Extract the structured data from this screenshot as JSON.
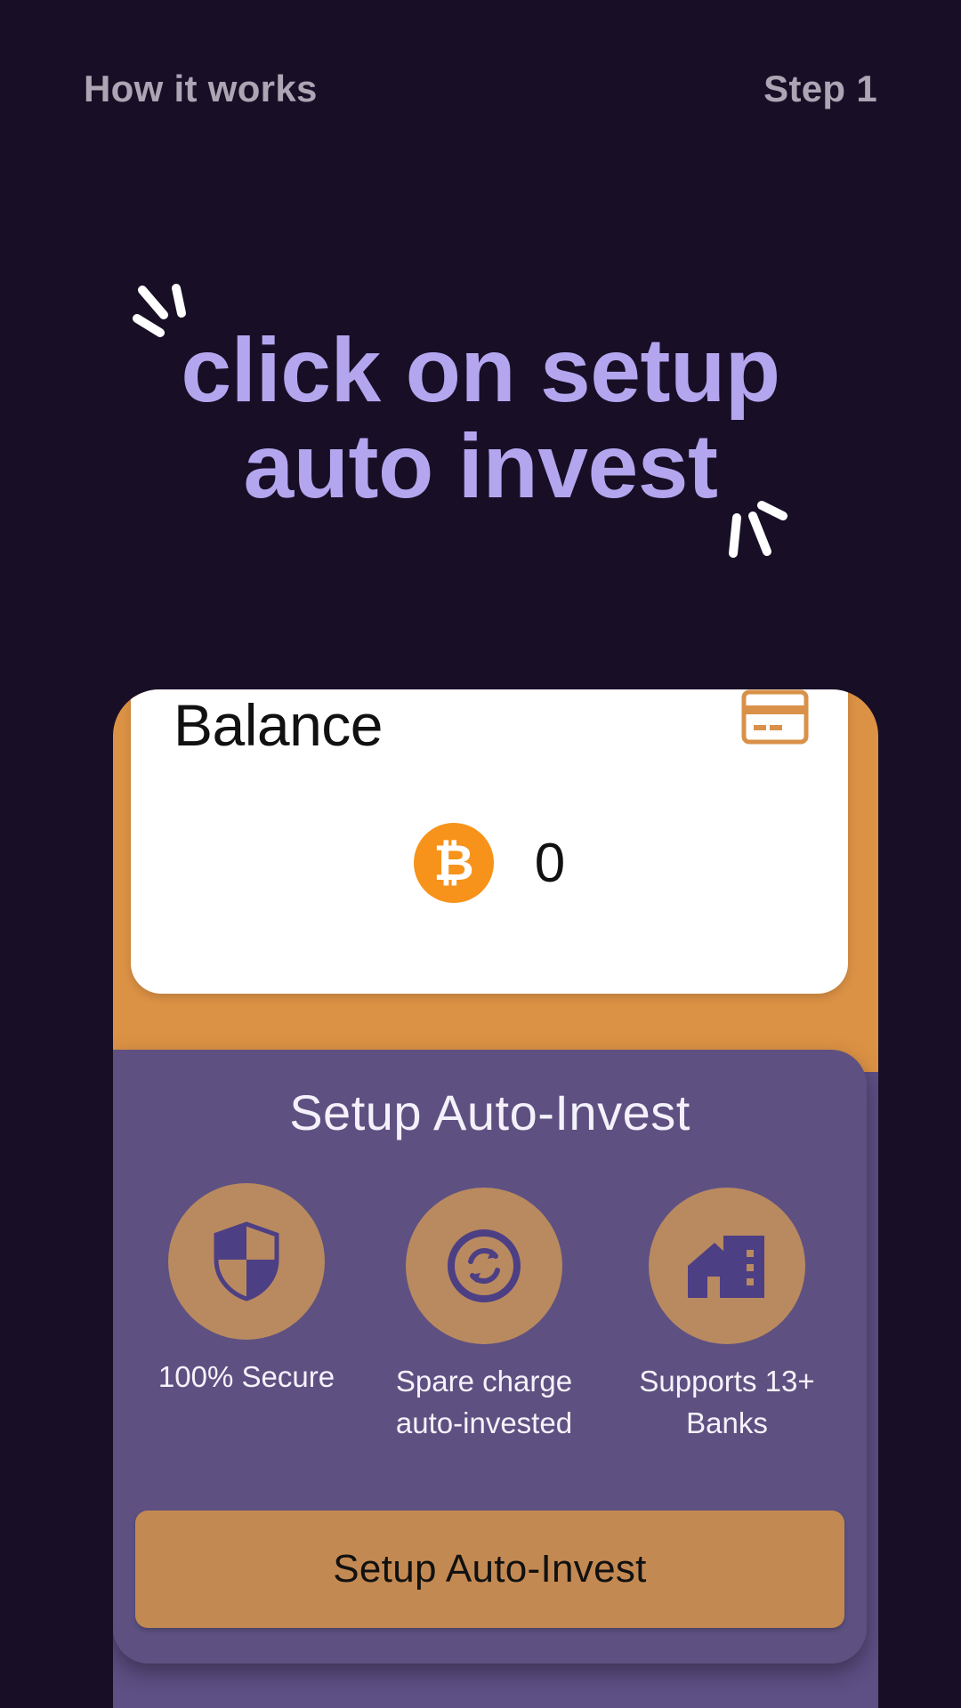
{
  "header": {
    "left_label": "How it works",
    "right_label": "Step 1"
  },
  "headline": {
    "line1": "click on setup",
    "line2": "auto invest"
  },
  "balance_card": {
    "title": "Balance",
    "amount": "0",
    "card_icon": "credit-card-icon",
    "coin_icon": "bitcoin-icon"
  },
  "setup": {
    "title": "Setup Auto-Invest",
    "features": [
      {
        "icon": "shield-icon",
        "label": "100% Secure"
      },
      {
        "icon": "sync-icon",
        "label": "Spare charge auto-invested"
      },
      {
        "icon": "bank-building-icon",
        "label": "Supports 13+ Banks"
      }
    ],
    "button_label": "Setup Auto-Invest"
  },
  "colors": {
    "background": "#180f26",
    "headline": "#b4a6ee",
    "accent_orange": "#dc9245",
    "panel_purple": "#5e5181",
    "button": "#c38952",
    "bitcoin": "#f7931a"
  }
}
